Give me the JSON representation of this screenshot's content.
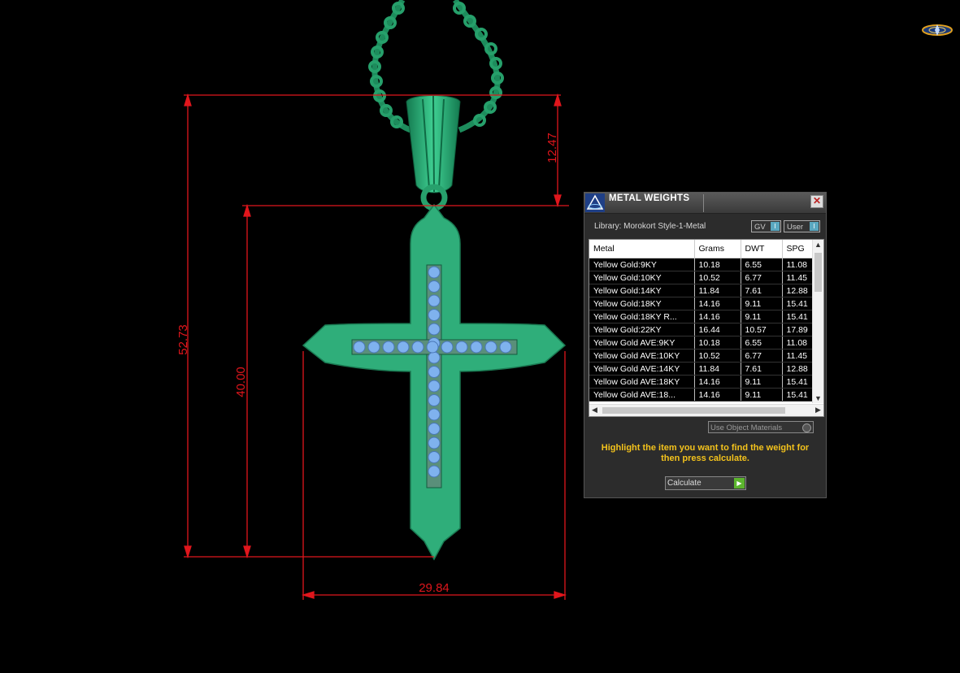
{
  "dimensions": {
    "overall_height": "52.73",
    "body_height": "40.00",
    "bail_height": "12.47",
    "width": "29.84"
  },
  "panel": {
    "title": "METAL WEIGHTS",
    "close_label": "✕",
    "library_label": "Library: Morokort Style-1-Metal",
    "gv_label": "GV",
    "user_label": "User",
    "columns": [
      "Metal",
      "Grams",
      "DWT",
      "SPG"
    ],
    "rows": [
      [
        "Yellow Gold:9KY",
        "10.18",
        "6.55",
        "11.08"
      ],
      [
        "Yellow Gold:10KY",
        "10.52",
        "6.77",
        "11.45"
      ],
      [
        "Yellow Gold:14KY",
        "11.84",
        "7.61",
        "12.88"
      ],
      [
        "Yellow Gold:18KY",
        "14.16",
        "9.11",
        "15.41"
      ],
      [
        "Yellow Gold:18KY R...",
        "14.16",
        "9.11",
        "15.41"
      ],
      [
        "Yellow Gold:22KY",
        "16.44",
        "10.57",
        "17.89"
      ],
      [
        "Yellow Gold AVE:9KY",
        "10.18",
        "6.55",
        "11.08"
      ],
      [
        "Yellow Gold AVE:10KY",
        "10.52",
        "6.77",
        "11.45"
      ],
      [
        "Yellow Gold AVE:14KY",
        "11.84",
        "7.61",
        "12.88"
      ],
      [
        "Yellow Gold AVE:18KY",
        "14.16",
        "9.11",
        "15.41"
      ],
      [
        "Yellow Gold AVE:18...",
        "14.16",
        "9.11",
        "15.41"
      ]
    ],
    "use_object_materials": "Use Object Materials",
    "hint": "Highlight the item you want to find the weight for then press calculate.",
    "calculate_label": "Calculate"
  },
  "colors": {
    "dimension_red": "#e0161c",
    "metal_green": "#2fae7a",
    "stone_blue": "#7fb2ee",
    "hint_yellow": "#f3c21c"
  }
}
